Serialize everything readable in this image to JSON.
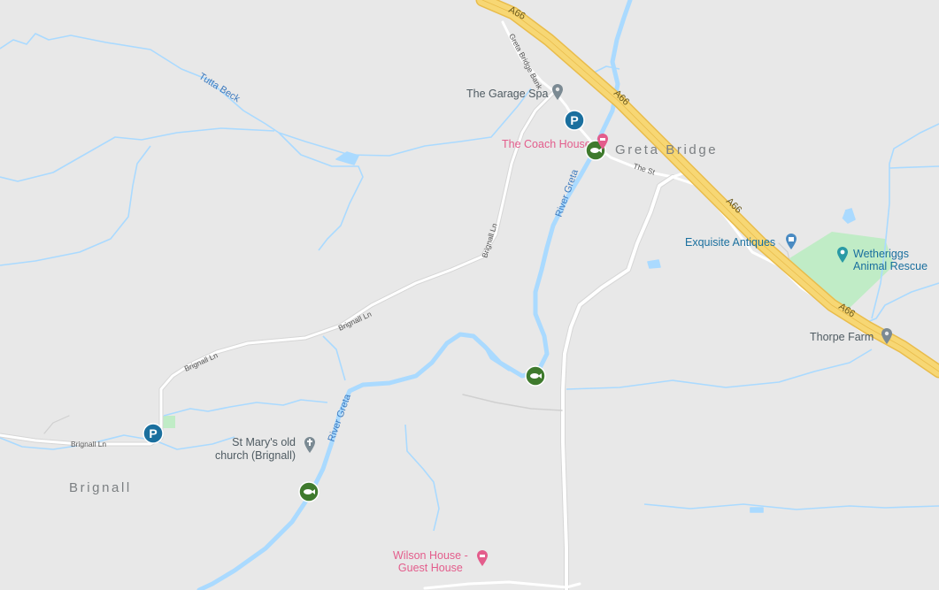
{
  "roads": {
    "a66_top": "A66",
    "a66_mid": "A66",
    "a66_low": "A66",
    "a66_bottom": "A66",
    "greta_bridge_bank": "Greta Bridge Bank",
    "the_st": "The St",
    "brignall_ln_1": "Brignall Ln",
    "brignall_ln_2": "Brignall Ln",
    "brignall_ln_3": "Brignall Ln",
    "brignall_ln_4": "Brignall Ln"
  },
  "water": {
    "tutta_beck": "Tutta Beck",
    "river_greta_north": "River Greta",
    "river_greta_south": "River Greta"
  },
  "places": {
    "greta_bridge": "Greta Bridge",
    "brignall": "Brignall",
    "garage_spa": "The Garage Spa",
    "coach_house": "The Coach House",
    "exquisite_antiques": "Exquisite Antiques",
    "wetheriggs_line1": "Wetheriggs",
    "wetheriggs_line2": "Animal Rescue",
    "thorpe_farm": "Thorpe Farm",
    "st_marys_line1": "St Mary's old",
    "st_marys_line2": "church (Brignall)",
    "wilson_line1": "Wilson House -",
    "wilson_line2": "Guest House"
  },
  "colors": {
    "land": "#e8e8e8",
    "water": "#aadaff",
    "water_text": "#3e7bbf",
    "motorway": "#f7d774",
    "park": "#c0ecc6",
    "parking": "#1a6f9e",
    "fishing": "#3f7a2d",
    "hotel": "#e35d8c"
  },
  "icons": {
    "parking": "parking-icon",
    "fishing": "fish-icon",
    "pin": "map-pin-icon",
    "shop": "shopping-bag-icon",
    "camera": "camera-icon",
    "hotel": "bed-icon",
    "church": "cross-icon"
  }
}
